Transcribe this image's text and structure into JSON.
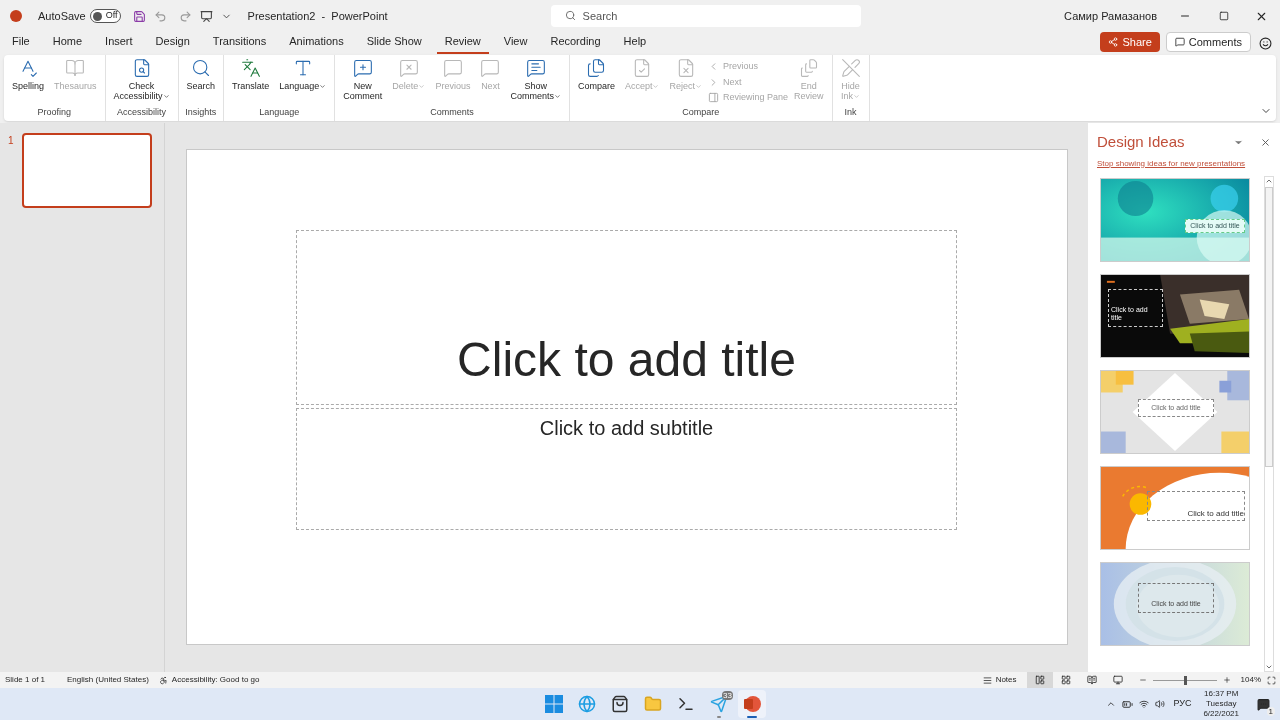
{
  "title_bar": {
    "autosave_label": "AutoSave",
    "autosave": {
      "on": false,
      "label": "Off"
    },
    "document_title": "Presentation2  -  PowerPoint",
    "search": {
      "placeholder": "Search"
    },
    "user": "Самир Рамазанов"
  },
  "menu_tabs": [
    {
      "label": "File",
      "selected": false
    },
    {
      "label": "Home",
      "selected": false
    },
    {
      "label": "Insert",
      "selected": false
    },
    {
      "label": "Design",
      "selected": false
    },
    {
      "label": "Transitions",
      "selected": false
    },
    {
      "label": "Animations",
      "selected": false
    },
    {
      "label": "Slide Show",
      "selected": false
    },
    {
      "label": "Review",
      "selected": true
    },
    {
      "label": "View",
      "selected": false
    },
    {
      "label": "Recording",
      "selected": false
    },
    {
      "label": "Help",
      "selected": false
    }
  ],
  "share_button": "Share",
  "comments_button": "Comments",
  "ribbon": {
    "groups": [
      {
        "name": "Proofing",
        "items": [
          {
            "kind": "large",
            "lines": [
              "Spelling"
            ],
            "disabled": false,
            "dropdown": false
          },
          {
            "kind": "large",
            "lines": [
              "Thesaurus"
            ],
            "disabled": true,
            "dropdown": false
          }
        ]
      },
      {
        "name": "Accessibility",
        "items": [
          {
            "kind": "large",
            "lines": [
              "Check",
              "Accessibility"
            ],
            "disabled": false,
            "dropdown": true
          }
        ]
      },
      {
        "name": "Insights",
        "items": [
          {
            "kind": "large",
            "lines": [
              "Search"
            ],
            "disabled": false,
            "dropdown": false
          }
        ]
      },
      {
        "name": "Language",
        "items": [
          {
            "kind": "large",
            "lines": [
              "Translate"
            ],
            "disabled": false,
            "dropdown": false
          },
          {
            "kind": "large",
            "lines": [
              "Language"
            ],
            "disabled": false,
            "dropdown": true
          }
        ]
      },
      {
        "name": "Comments",
        "items": [
          {
            "kind": "large",
            "lines": [
              "New",
              "Comment"
            ],
            "disabled": false,
            "dropdown": false
          },
          {
            "kind": "large",
            "lines": [
              "Delete"
            ],
            "disabled": true,
            "dropdown": true
          },
          {
            "kind": "large",
            "lines": [
              "Previous"
            ],
            "disabled": true,
            "dropdown": false
          },
          {
            "kind": "large",
            "lines": [
              "Next"
            ],
            "disabled": true,
            "dropdown": false
          },
          {
            "kind": "large",
            "lines": [
              "Show",
              "Comments"
            ],
            "disabled": false,
            "dropdown": true
          }
        ]
      },
      {
        "name": "Compare",
        "items": [
          {
            "kind": "large",
            "lines": [
              "Compare"
            ],
            "disabled": false,
            "dropdown": false
          },
          {
            "kind": "large",
            "lines": [
              "Accept"
            ],
            "disabled": true,
            "dropdown": true
          },
          {
            "kind": "large",
            "lines": [
              "Reject"
            ],
            "disabled": true,
            "dropdown": true
          },
          {
            "kind": "stack",
            "items": [
              {
                "label": "Previous",
                "disabled": true
              },
              {
                "label": "Next",
                "disabled": true
              },
              {
                "label": "Reviewing Pane",
                "disabled": true
              }
            ]
          },
          {
            "kind": "large",
            "lines": [
              "End",
              "Review"
            ],
            "disabled": true,
            "dropdown": false
          }
        ]
      },
      {
        "name": "Ink",
        "items": [
          {
            "kind": "large",
            "lines": [
              "Hide",
              "Ink"
            ],
            "disabled": true,
            "dropdown": true
          }
        ]
      }
    ]
  },
  "slides": [
    {
      "number": "1",
      "selected": true
    }
  ],
  "slide": {
    "title_placeholder": "Click to add title",
    "subtitle_placeholder": "Click to add subtitle"
  },
  "design_ideas": {
    "title": "Design Ideas",
    "link": "Stop showing ideas for new presentations",
    "ideas": [
      {
        "title": "Click to add title"
      },
      {
        "title": "Click to add title"
      },
      {
        "title": "Click to add title"
      },
      {
        "title": "Click to add title"
      },
      {
        "title": "Click to add title"
      }
    ]
  },
  "status_bar": {
    "slide": "Slide 1 of 1",
    "language": "English (United States)",
    "accessibility": "Accessibility: Good to go",
    "notes": "Notes",
    "views": [
      {
        "selected": true
      },
      {
        "selected": false
      },
      {
        "selected": false
      },
      {
        "selected": false
      }
    ],
    "zoom": {
      "level": 0.5,
      "reading": "104%"
    }
  },
  "taskbar": {
    "apps": [
      {
        "running": false,
        "selected": false
      },
      {
        "running": false,
        "selected": false
      },
      {
        "running": false,
        "selected": false
      },
      {
        "running": false,
        "selected": false
      },
      {
        "running": false,
        "selected": false
      },
      {
        "running": true,
        "selected": false,
        "badge": "33"
      },
      {
        "running": true,
        "selected": true
      }
    ],
    "input_language": "РУС",
    "time": "16:37 PM",
    "day": "Tuesday",
    "date": "6/22/2021",
    "notifications": "1"
  }
}
